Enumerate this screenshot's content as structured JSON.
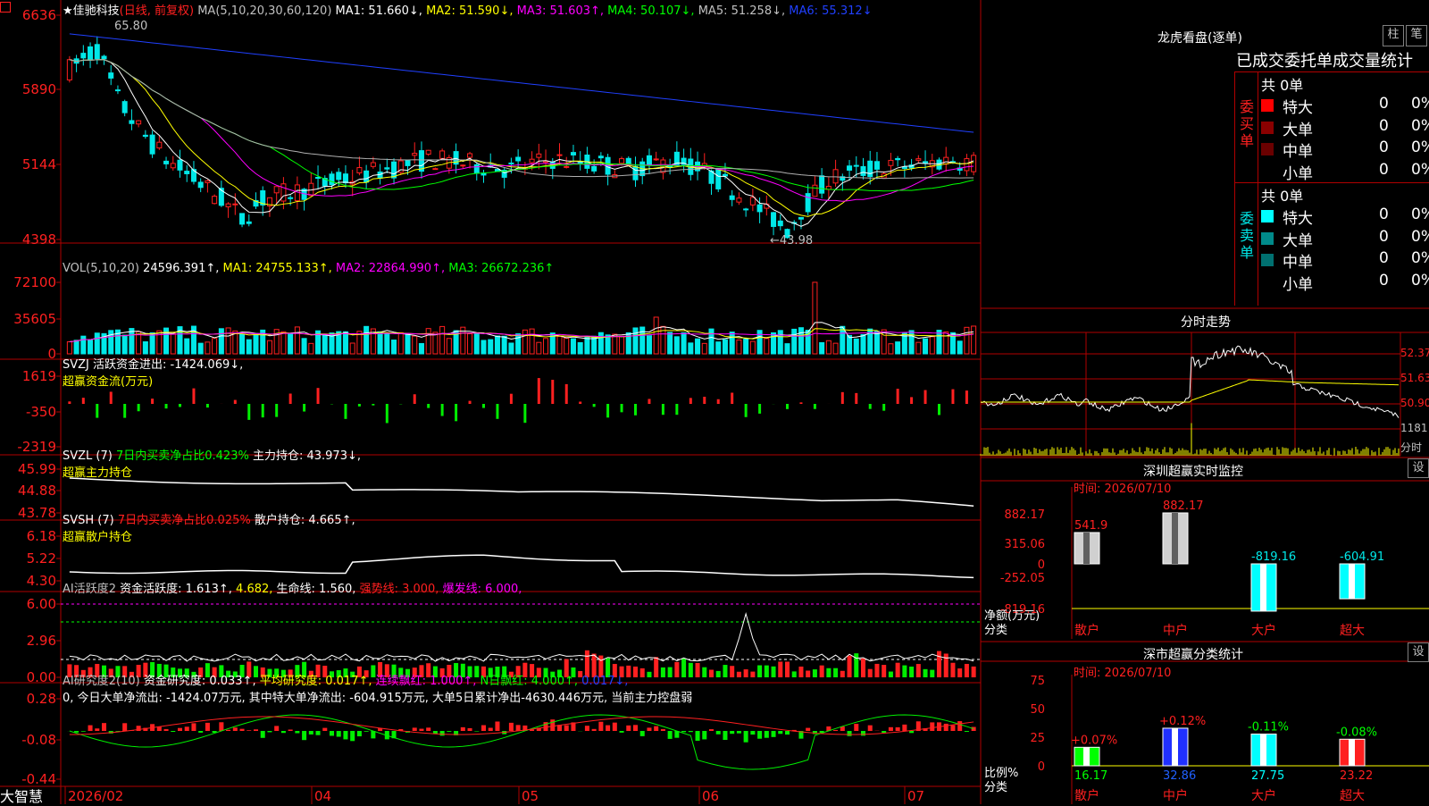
{
  "colors": {
    "up": "#ff2020",
    "down": "#00e8e8",
    "grid": "#b00000",
    "ma1": "#ffffff",
    "ma2": "#ffff00",
    "ma3": "#ff00ff",
    "ma4": "#00ff00",
    "ma5": "#b0b0b0",
    "ma6": "#2040ff",
    "green": "#00ee00",
    "red": "#ff2020"
  },
  "main": {
    "stock": "★佳驰科技",
    "mode": "(日线, 前复权)",
    "ma_head": "MA(5,10,20,30,60,120)",
    "ma": [
      {
        "label": "MA1: 51.660↓,",
        "color": "#ffffff"
      },
      {
        "label": "MA2: 51.590↓,",
        "color": "#ffff00"
      },
      {
        "label": "MA3: 51.603↑,",
        "color": "#ff00ff"
      },
      {
        "label": "MA4: 50.107↓,",
        "color": "#00ff00"
      },
      {
        "label": "MA5: 51.258↓,",
        "color": "#c0c0c0"
      },
      {
        "label": "MA6: 55.312↓",
        "color": "#2040ff"
      }
    ],
    "yticks": [
      "6636",
      "5890",
      "5144",
      "4398"
    ],
    "high_label": "65.80",
    "low_label": "←43.98"
  },
  "vol": {
    "head": "VOL(5,10,20)",
    "value": "24596.391↑,",
    "ma1": "MA1: 24755.133↑,",
    "ma2": "MA2: 22864.990↑,",
    "ma3": "MA3: 26672.236↑",
    "yticks": [
      "72100",
      "35605",
      "0"
    ]
  },
  "svzj": {
    "head": "SVZJ  活跃资金进出: -1424.069↓,",
    "sub": "超赢资金流(万元)",
    "yticks": [
      "1619",
      "-350",
      "-2319"
    ]
  },
  "svzl": {
    "head": "SVZL (7)",
    "t1": "7日内买卖净占比0.423%",
    "t2": "主力持仓: 43.973↓,",
    "sub": "超赢主力持仓",
    "yticks": [
      "45.99",
      "44.88",
      "43.78"
    ]
  },
  "svsh": {
    "head": "SVSH (7)",
    "t1": "7日内买卖净占比0.025%",
    "t2": "散户持仓: 4.665↑,",
    "sub": "超赢散户持仓",
    "yticks": [
      "6.18",
      "5.22",
      "4.30"
    ]
  },
  "ai2": {
    "head": "AI活跃度2",
    "t1": "资金活跃度: 1.613↑,",
    "t2": "4.682,",
    "t3": "生命线: 1.560,",
    "t4": "强势线: 3.000,",
    "t5": "爆发线: 6.000,",
    "yticks": [
      "6.00",
      "2.96",
      "0.00"
    ]
  },
  "ai3": {
    "head": "AI研究度2(10)",
    "t1": "资金研究度: 0.033↑,",
    "t2": "平均研究度: 0.017↑,",
    "t3": "连续飘红: 1.000↑,",
    "t4": "N日飘红: 4.000↑,",
    "t5": "0.017↓,",
    "line2": "0, 今日大单净流出: -1424.07万元, 其中特大单净流出: -604.915万元, 大单5日累计净出-4630.446万元, 当前主力控盘弱",
    "yticks": [
      "0.28",
      "-0.08",
      "-0.44"
    ]
  },
  "xaxis": {
    "brand": "大智慧",
    "labels": [
      "2026/02",
      "04",
      "05",
      "06",
      "07"
    ]
  },
  "right": {
    "title": "龙虎看盘(逐单)",
    "btn1": "柱",
    "btn2": "笔",
    "stat_title": "已成交委托单成交量统计",
    "buy_side": "委买单",
    "sell_side": "委卖单",
    "buy_total": "共 0单",
    "sell_total": "共 0单",
    "buy_rows": [
      {
        "name": "特大",
        "val": "0",
        "pct": "0%",
        "color": "#ff0000"
      },
      {
        "name": "大单",
        "val": "0",
        "pct": "0%",
        "color": "#8a0000"
      },
      {
        "name": "中单",
        "val": "0",
        "pct": "0%",
        "color": "#6a0000"
      },
      {
        "name": "小单",
        "val": "0",
        "pct": "0%",
        "color": "#000000"
      }
    ],
    "sell_rows": [
      {
        "name": "特大",
        "val": "0",
        "pct": "0%",
        "color": "#00ffff"
      },
      {
        "name": "大单",
        "val": "0",
        "pct": "0%",
        "color": "#008a8a"
      },
      {
        "name": "中单",
        "val": "0",
        "pct": "0%",
        "color": "#007070"
      },
      {
        "name": "小单",
        "val": "0",
        "pct": "0%",
        "color": "#000000"
      }
    ],
    "fenshi_title": "分时走势",
    "fenshi_y": [
      "52.37",
      "51.63",
      "50.90",
      "1181",
      "分时"
    ],
    "sz_title": "深圳超赢实时监控",
    "sz_btn": "设",
    "sz_time": "时间: 2026/07/10",
    "sz_y": [
      "882.17",
      "315.06",
      "0",
      "-252.05",
      "-819.16"
    ],
    "sz_bars": [
      {
        "label": "散户",
        "value": "541.9",
        "num": 541.9,
        "color": "#d0d0d0",
        "lcolor": "#ff2020"
      },
      {
        "label": "中户",
        "value": "882.17",
        "num": 882.17,
        "color": "#d0d0d0",
        "lcolor": "#ff2020"
      },
      {
        "label": "大户",
        "value": "-819.16",
        "num": -819.16,
        "color": "#00ffff",
        "lcolor": "#00e8e8"
      },
      {
        "label": "超大",
        "value": "-604.91",
        "num": -604.91,
        "color": "#00ffff",
        "lcolor": "#00e8e8"
      }
    ],
    "sz_ylabel": "净额(万元)",
    "sz_xlabel": "分类",
    "cls_title": "深市超赢分类统计",
    "cls_btn": "设",
    "cls_time": "时间: 2026/07/10",
    "cls_y": [
      "75",
      "50",
      "25",
      "0"
    ],
    "cls_bars": [
      {
        "label": "散户",
        "value": "16.17",
        "num": 16.17,
        "chg": "+0.07%",
        "color": "#00ff00"
      },
      {
        "label": "中户",
        "value": "32.86",
        "num": 32.86,
        "chg": "+0.12%",
        "color": "#2030ff"
      },
      {
        "label": "大户",
        "value": "27.75",
        "num": 27.75,
        "chg": "-0.11%",
        "color": "#00ffff"
      },
      {
        "label": "超大",
        "value": "23.22",
        "num": 23.22,
        "chg": "-0.08%",
        "color": "#ff2020"
      }
    ],
    "cls_ylabel": "比例%",
    "cls_xlabel": "分类"
  }
}
